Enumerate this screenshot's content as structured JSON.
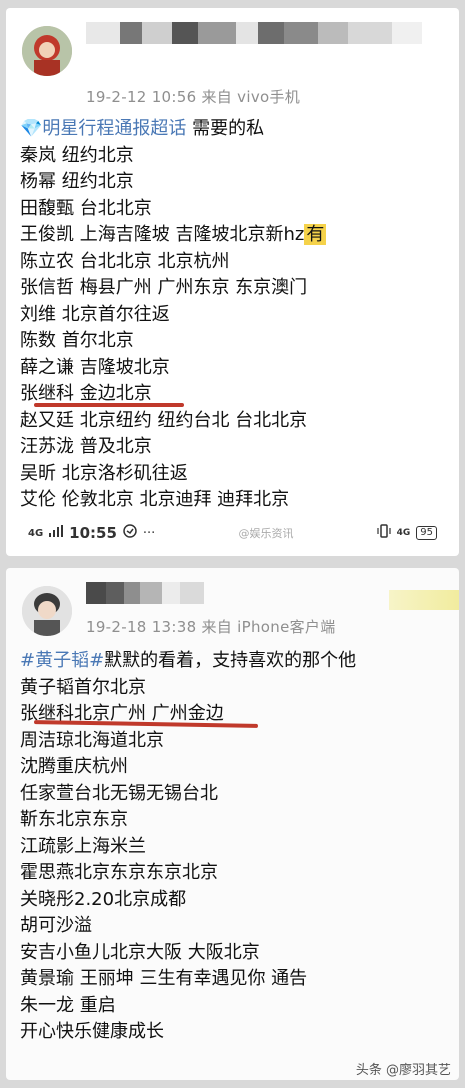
{
  "post1": {
    "meta": "19-2-12 10:56  来自 vivo手机",
    "topic": "💎明星行程通报超话",
    "intro_rest": " 需要的私",
    "lines": [
      "秦岚 纽约北京",
      "杨幂 纽约北京",
      "田馥甄 台北北京",
      "王俊凯 上海吉隆坡 吉隆坡北京新hz",
      "陈立农 台北北京 北京杭州",
      "张信哲 梅县广州 广州东京 东京澳门",
      "刘维 北京首尔往返",
      "陈数 首尔北京",
      "薛之谦 吉隆坡北京",
      "张继科 金边北京",
      "赵又廷 北京纽约 纽约台北 台北北京",
      "汪苏泷 普及北京",
      "吴昕 北京洛杉矶往返",
      "艾伦 伦敦北京 北京迪拜 迪拜北京"
    ],
    "hz_tag": "有",
    "status": {
      "signal": "4G",
      "time": "10:55",
      "watermark": "@娱乐资讯",
      "battery": "95"
    }
  },
  "post2": {
    "meta": "19-2-18 13:38  来自 iPhone客户端",
    "topic": "#黄子韬#",
    "intro_rest": "默默的看着，支持喜欢的那个他",
    "lines": [
      "黄子韬首尔北京",
      "张继科北京广州 广州金边",
      "周洁琼北海道北京",
      "沈腾重庆杭州",
      "任家萱台北无锡无锡台北",
      "靳东北京东京",
      "江疏影上海米兰",
      "霍思燕北京东京东京北京",
      "关晓彤2.20北京成都",
      "胡可沙溢",
      "安吉小鱼儿北京大阪 大阪北京",
      "黄景瑜 王丽坤 三生有幸遇见你 通告",
      "朱一龙 重启",
      "开心快乐健康成长"
    ]
  },
  "footer": "头条 @廖羽其艺"
}
